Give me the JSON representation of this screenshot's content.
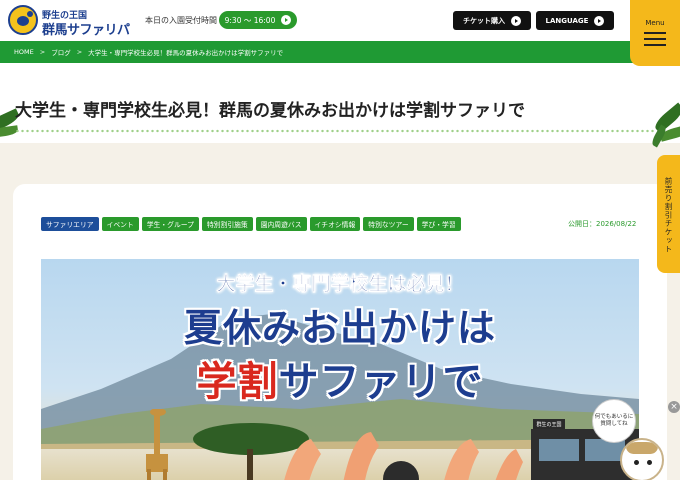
{
  "header": {
    "logo_sub": "野生の王国",
    "logo_main": "群馬サファリパーク",
    "hours_label": "本日の入園受付時間",
    "hours_value": "9:30 〜 16:00",
    "ticket_button": "チケット購入",
    "language_button": "LANGUAGE",
    "menu_label": "Menu"
  },
  "breadcrumb": {
    "items": [
      "HOME",
      "ブログ",
      "大学生・専門学校生必見！群馬の夏休みお出かけは学割サファリで"
    ],
    "separator": ">"
  },
  "page": {
    "title": "大学生・専門学校生必見！群馬の夏休みお出かけは学割サファリで"
  },
  "side_tab": {
    "label": "前売り割引チケット"
  },
  "article": {
    "tags": [
      {
        "label": "サファリエリア",
        "color": "blue"
      },
      {
        "label": "イベント",
        "color": "green"
      },
      {
        "label": "学生・グループ",
        "color": "green"
      },
      {
        "label": "特別割引施策",
        "color": "green"
      },
      {
        "label": "園内周遊バス",
        "color": "green"
      },
      {
        "label": "イチオシ情報",
        "color": "green"
      },
      {
        "label": "特別なツアー",
        "color": "green"
      },
      {
        "label": "学び・学習",
        "color": "green"
      }
    ],
    "published": "公開日：2026/08/22",
    "hero": {
      "subtitle": "大学生・専門学校生は必見！",
      "line1": "夏休みお出かけは",
      "line2_red": "学割",
      "line2_blue": "サファリで",
      "bubble_text": "何でもあいるに質問してね",
      "bus_sign": "群生の王国"
    }
  },
  "colors": {
    "brand_green": "#1f9a34",
    "brand_yellow": "#f4b81b",
    "brand_navy": "#1d3f8f",
    "accent_red": "#d9281e"
  },
  "icons": [
    "logo-icon",
    "arrow-circle-icon",
    "hamburger-icon",
    "close-icon",
    "mascot-icon"
  ]
}
